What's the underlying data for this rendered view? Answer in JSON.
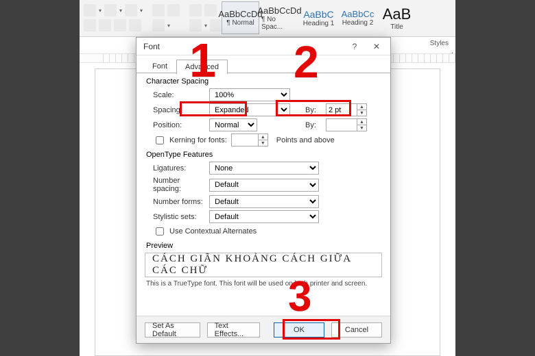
{
  "ribbon": {
    "styles_label": "Styles",
    "tiles": [
      {
        "sample": "AaBbCcDd",
        "label": "¶ Normal",
        "cls": ""
      },
      {
        "sample": "AaBbCcDd",
        "label": "¶ No Spac...",
        "cls": ""
      },
      {
        "sample": "AaBbC",
        "label": "Heading 1",
        "cls": "h1"
      },
      {
        "sample": "AaBbCc",
        "label": "Heading 2",
        "cls": "h2"
      },
      {
        "sample": "AaB",
        "label": "Title",
        "cls": "title"
      }
    ]
  },
  "dialog": {
    "title": "Font",
    "tabs": {
      "font": "Font",
      "advanced": "Advanced"
    },
    "char_spacing": {
      "heading": "Character Spacing",
      "scale_label": "Scale:",
      "scale_value": "100%",
      "spacing_label": "Spacing:",
      "spacing_value": "Expanded",
      "by_label": "By:",
      "by_value": "2 pt",
      "position_label": "Position:",
      "position_value": "Normal",
      "by2_label": "By:",
      "by2_value": "",
      "kerning_label": "Kerning for fonts:",
      "kerning_value": "",
      "points_above": "Points and above"
    },
    "opentype": {
      "heading": "OpenType Features",
      "ligatures_label": "Ligatures:",
      "ligatures_value": "None",
      "numspacing_label": "Number spacing:",
      "numspacing_value": "Default",
      "numforms_label": "Number forms:",
      "numforms_value": "Default",
      "stylistic_label": "Stylistic sets:",
      "stylistic_value": "Default",
      "contextual_label": "Use Contextual Alternates"
    },
    "preview": {
      "heading": "Preview",
      "text": "CÁCH GIÃN KHOẢNG CÁCH GIỮA CÁC CHỮ",
      "note": "This is a TrueType font. This font will be used on both printer and screen."
    },
    "buttons": {
      "default": "Set As Default",
      "effects": "Text Effects...",
      "ok": "OK",
      "cancel": "Cancel"
    }
  },
  "callouts": {
    "one": "1",
    "two": "2",
    "three": "3"
  }
}
